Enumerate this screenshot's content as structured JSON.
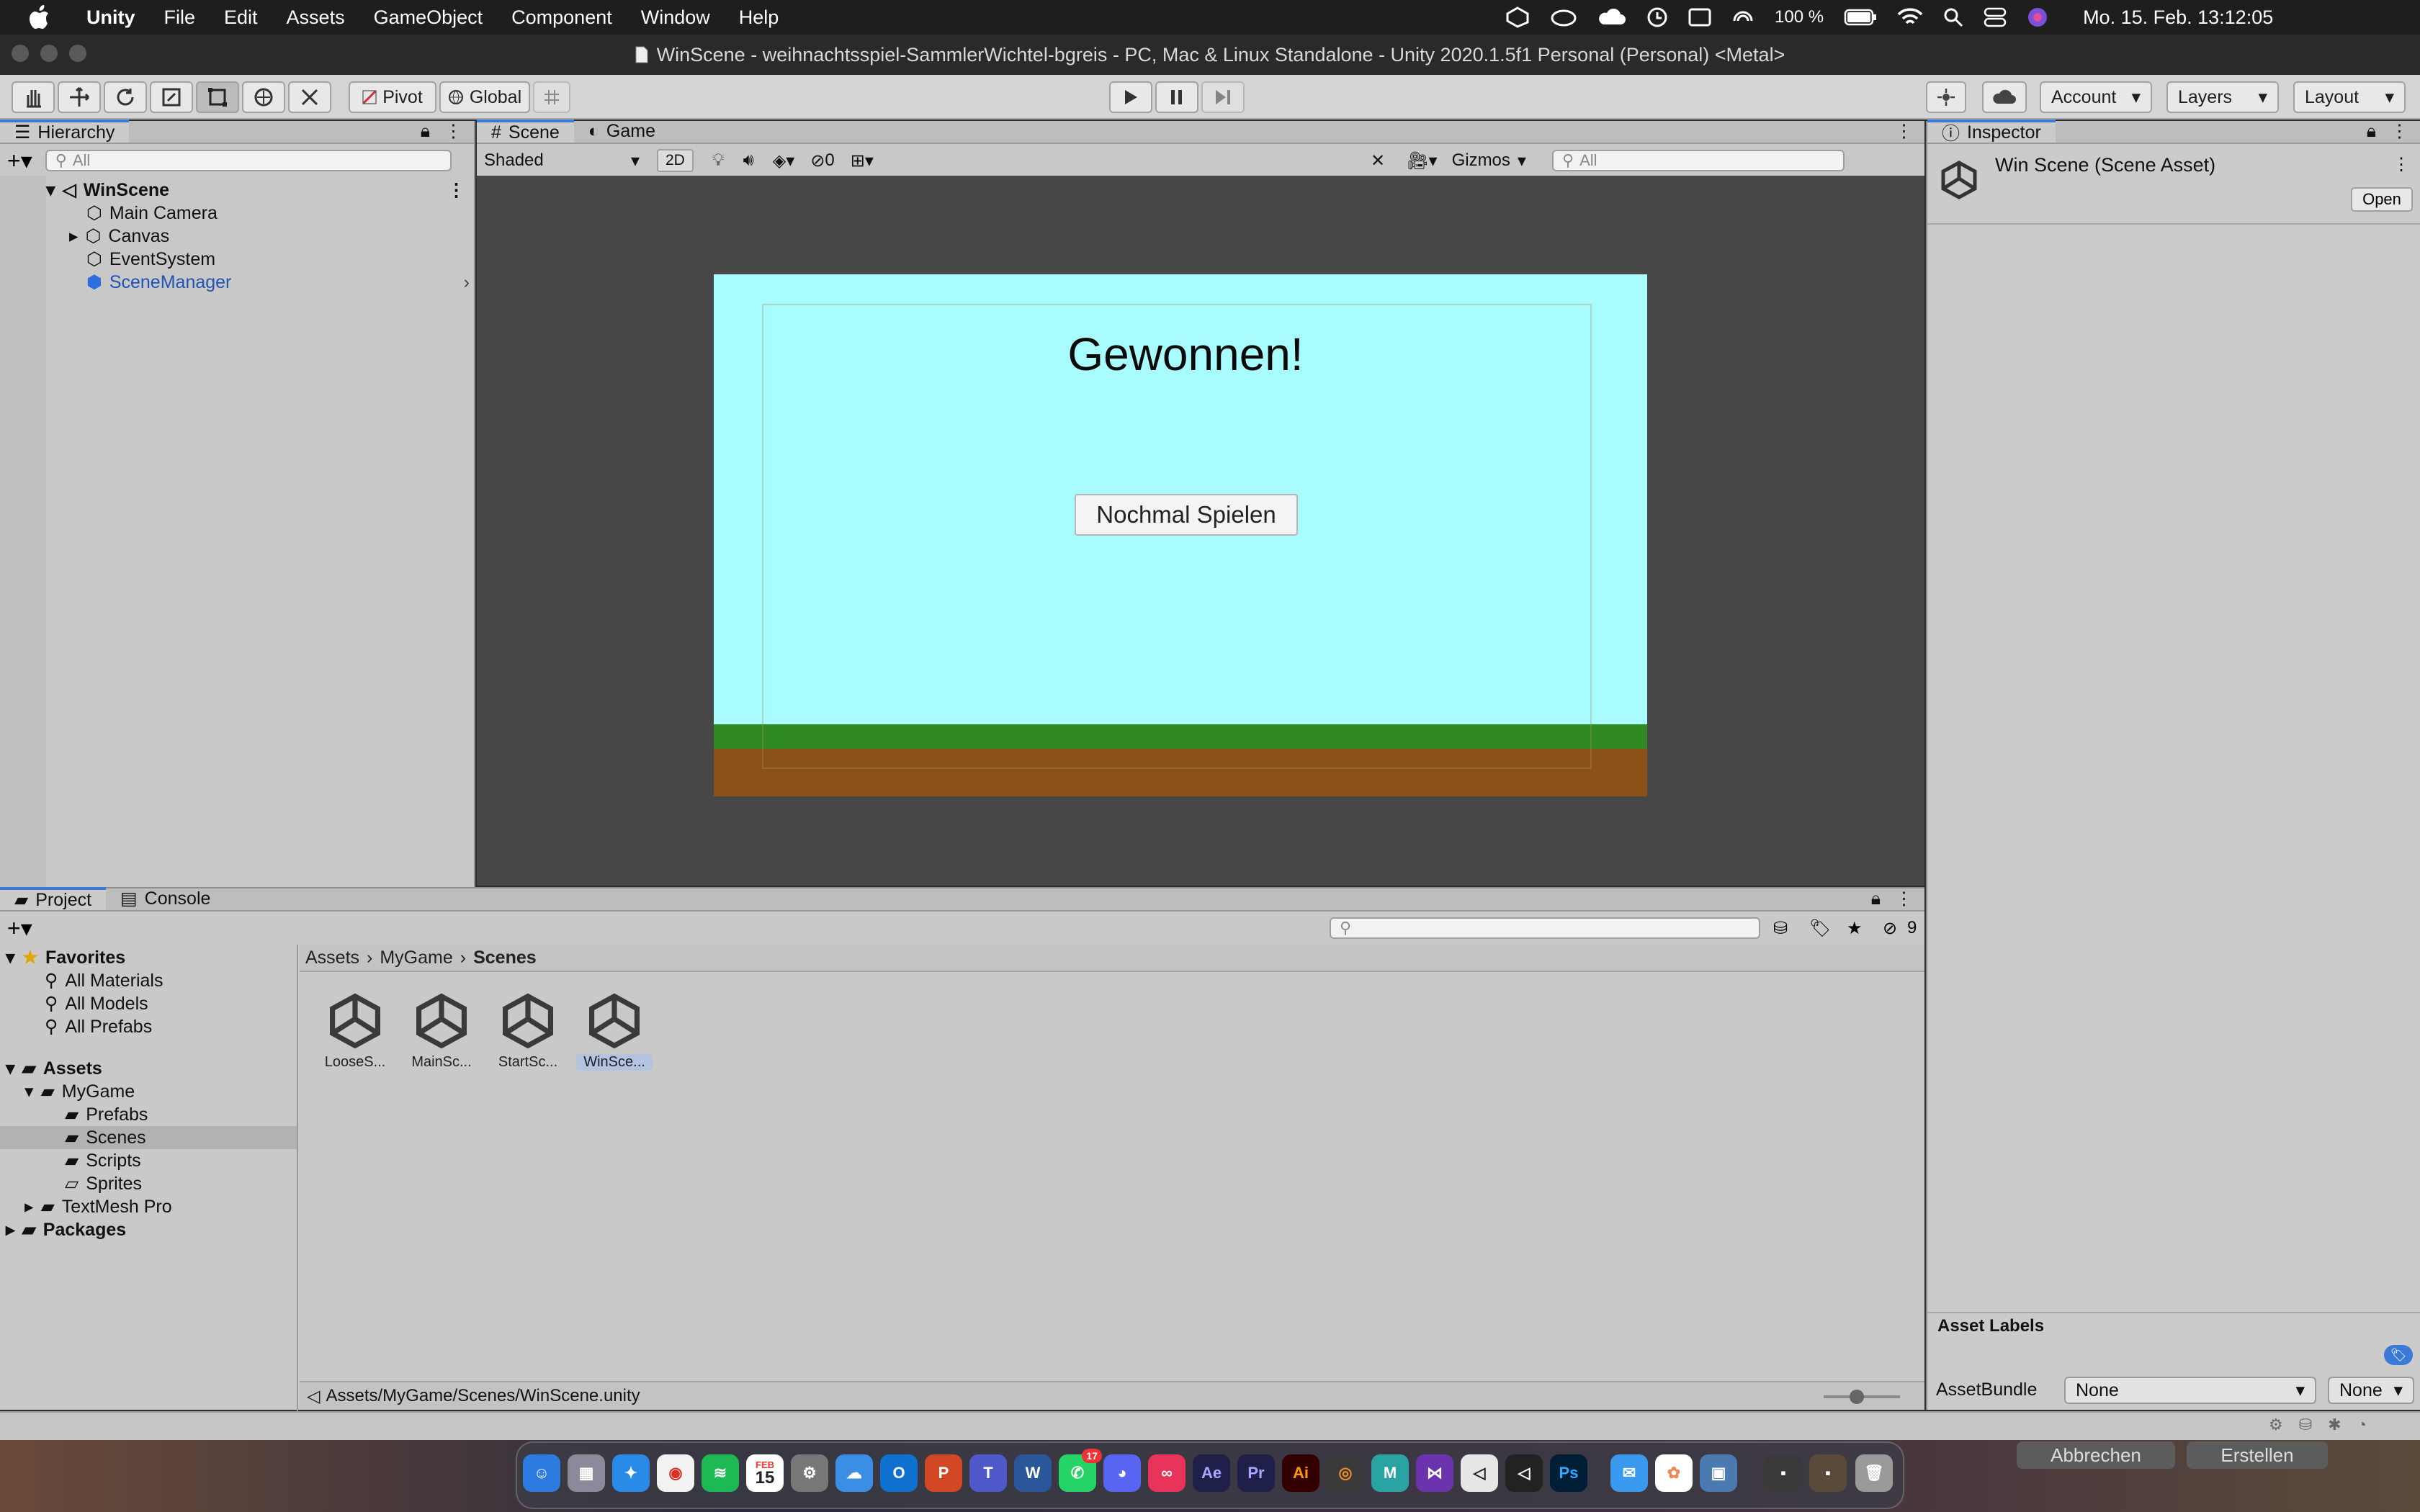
{
  "menubar": {
    "app": "Unity",
    "items": [
      "File",
      "Edit",
      "Assets",
      "GameObject",
      "Component",
      "Window",
      "Help"
    ],
    "battery": "100 %",
    "clock": "Mo. 15. Feb.  13:12:05"
  },
  "window": {
    "title": "WinScene - weihnachtsspiel-SammlerWichtel-bgreis - PC, Mac & Linux Standalone - Unity 2020.1.5f1 Personal (Personal) <Metal>"
  },
  "toolbar": {
    "pivot": "Pivot",
    "global": "Global",
    "account": "Account",
    "layers": "Layers",
    "layout": "Layout"
  },
  "hierarchy": {
    "tab": "Hierarchy",
    "search_placeholder": "All",
    "scene": "WinScene",
    "items": [
      "Main Camera",
      "Canvas",
      "EventSystem",
      "SceneManager"
    ]
  },
  "scene": {
    "tab_scene": "Scene",
    "tab_game": "Game",
    "shading": "Shaded",
    "mode_2d": "2D",
    "hidden_count": "0",
    "gizmos": "Gizmos",
    "search_placeholder": "All"
  },
  "game_ui": {
    "title": "Gewonnen!",
    "button": "Nochmal Spielen",
    "colors": {
      "sky": "#a9fcfd",
      "grass": "#2f8a22",
      "dirt": "#8a5218"
    }
  },
  "inspector": {
    "tab": "Inspector",
    "asset_title": "Win Scene (Scene Asset)",
    "open": "Open",
    "labels_header": "Asset Labels",
    "assetbundle_label": "AssetBundle",
    "assetbundle_value": "None",
    "variant_value": "None"
  },
  "project": {
    "tab_project": "Project",
    "tab_console": "Console",
    "hidden_count": "9",
    "favorites": {
      "label": "Favorites",
      "items": [
        "All Materials",
        "All Models",
        "All Prefabs"
      ]
    },
    "assets": {
      "label": "Assets",
      "mygame": "MyGame",
      "children": [
        "Prefabs",
        "Scenes",
        "Scripts",
        "Sprites"
      ],
      "textmesh": "TextMesh Pro"
    },
    "packages": "Packages",
    "breadcrumb": [
      "Assets",
      "MyGame",
      "Scenes"
    ],
    "files": [
      "LooseS...",
      "MainSc...",
      "StartSc...",
      "WinSce..."
    ],
    "status_path": "Assets/MyGame/Scenes/WinScene.unity"
  },
  "dialog_buttons": {
    "cancel": "Abbrechen",
    "create": "Erstellen"
  },
  "dock": {
    "calendar_month": "FEB",
    "calendar_day": "15",
    "whatsapp_badge": "17",
    "apps": [
      "finder-icon",
      "launchpad-icon",
      "safari-icon",
      "chrome-icon",
      "spotify-icon",
      "calendar-icon",
      "system-preferences-icon",
      "onedrive-icon",
      "outlook-icon",
      "powerpoint-icon",
      "teams-icon",
      "word-icon",
      "whatsapp-icon",
      "discord-icon",
      "creative-cloud-icon",
      "after-effects-icon",
      "premiere-icon",
      "illustrator-icon",
      "blender-icon",
      "maya-icon",
      "visual-studio-icon",
      "unity-hub-icon",
      "unity-icon",
      "photoshop-icon",
      "mail-icon",
      "photos-icon",
      "preview-icon",
      "trash-icon"
    ]
  }
}
